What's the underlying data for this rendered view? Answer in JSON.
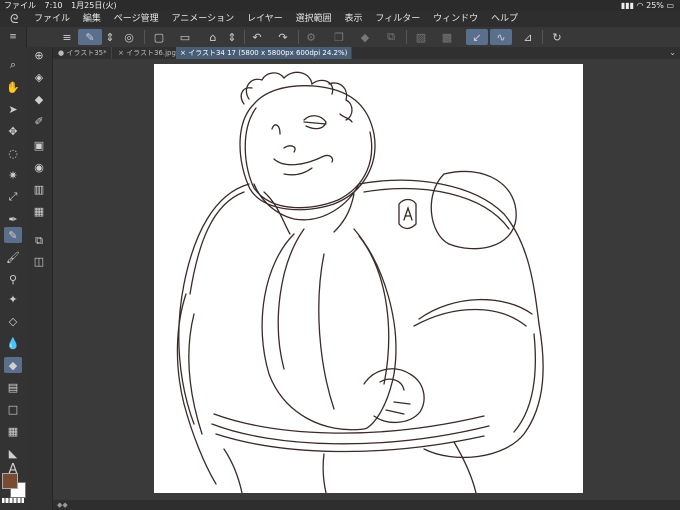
{
  "status": {
    "app": "ファイル",
    "time": "7:10",
    "date": "1月25日(火)",
    "battery": "25%"
  },
  "menu": [
    "ファイル",
    "編集",
    "ページ管理",
    "アニメーション",
    "レイヤー",
    "選択範囲",
    "表示",
    "フィルター",
    "ウィンドウ",
    "ヘルプ"
  ],
  "tabs": [
    {
      "label": "● イラスト35*"
    },
    {
      "label": "× イラスト36.jpg"
    },
    {
      "label": "× イラスト34 17 (5800 x 5800px 600dpi 24.2%)"
    }
  ],
  "tools": {
    "text_tool": "A"
  },
  "colors": {
    "main": "#7a4a33",
    "sub": "#ffffff",
    "accent": "#5a6f8c",
    "stroke": "#3a2a28"
  }
}
